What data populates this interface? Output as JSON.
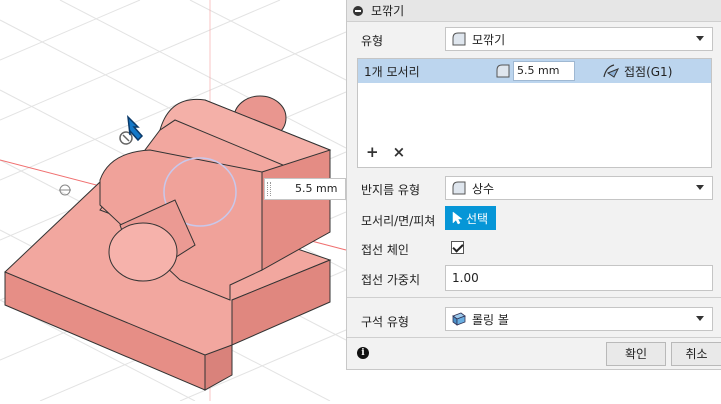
{
  "panel": {
    "title": "모깎기",
    "type_label": "유형",
    "type_value": "모깎기",
    "edge_list": {
      "row_label": "1개 모서리",
      "radius_value": "5.5 mm",
      "tangency": "접점(G1)",
      "add_icon": "plus-icon",
      "remove_icon": "x-icon"
    },
    "radius_type_label": "반지름 유형",
    "radius_type_value": "상수",
    "edges_label": "모서리/면/피쳐",
    "select_label": "선택",
    "tangent_chain_label": "접선 체인",
    "tangent_chain_checked": true,
    "tangent_weight_label": "접선 가중치",
    "tangent_weight_value": "1.00",
    "corner_type_label": "구석 유형",
    "corner_type_value": "롤링 볼",
    "ok_label": "확인",
    "cancel_label": "취소"
  },
  "viewport": {
    "radius_input_value": "5.5 mm",
    "manipulator_icon": "blue-arrow-manipulator-icon"
  },
  "colors": {
    "model": "#f2a79f",
    "accent": "#0696d7",
    "selection": "#bcd5ee"
  }
}
